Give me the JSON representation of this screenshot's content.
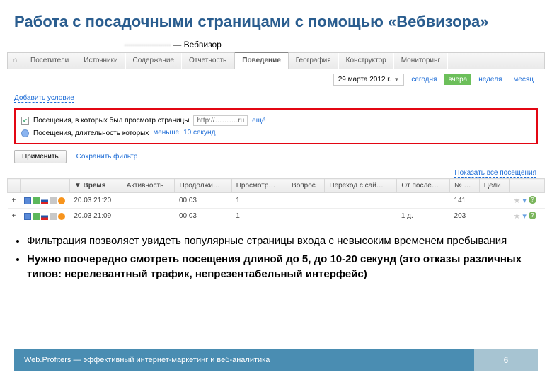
{
  "slide": {
    "title": "Работа с посадочными страницами с помощью «Вебвизора»"
  },
  "app": {
    "site_suffix": " — Вебвизор",
    "tabs": [
      "Посетители",
      "Источники",
      "Содержание",
      "Отчетность",
      "Поведение",
      "География",
      "Конструктор",
      "Мониторинг"
    ],
    "active_tab_index": 4,
    "date_label": "29 марта 2012 г.",
    "period": {
      "today": "сегодня",
      "yesterday": "вчера",
      "week": "неделя",
      "month": "месяц"
    },
    "add_condition": "Добавить условие",
    "filter": {
      "line1_a": "Посещения, в которых был просмотр страницы",
      "line1_url": "http://……….ru",
      "line1_more": "ещё",
      "line2_a": "Посещения, длительность которых",
      "line2_op": "меньше",
      "line2_val": "10 секунд"
    },
    "apply": "Применить",
    "save_filter": "Сохранить фильтр",
    "show_all": "Показать все посещения"
  },
  "table": {
    "headers": [
      "",
      "",
      "Время",
      "Активность",
      "Продолжи…",
      "Просмотр…",
      "Вопрос",
      "Переход с сай…",
      "От после…",
      "№ …",
      "Цели",
      ""
    ],
    "sorted_col": 2,
    "rows": [
      {
        "time": "20.03 21:20",
        "dur": "00:03",
        "views": "1",
        "since": "",
        "num": "141"
      },
      {
        "time": "20.03 21:09",
        "dur": "00:03",
        "views": "1",
        "since": "1 д.",
        "num": "203"
      }
    ]
  },
  "bullets": {
    "b1": "Фильтрация позволяет увидеть популярные страницы входа с невысоким временем пребывания",
    "b2": "Нужно поочередно смотреть посещения длиной до 5, до 10-20 секунд (это отказы различных типов: нерелевантный трафик, непрезентабельный интерфейс)"
  },
  "footer": {
    "text": "Web.Profiters — эффективный интернет-маркетинг и веб-аналитика",
    "page": "6"
  }
}
